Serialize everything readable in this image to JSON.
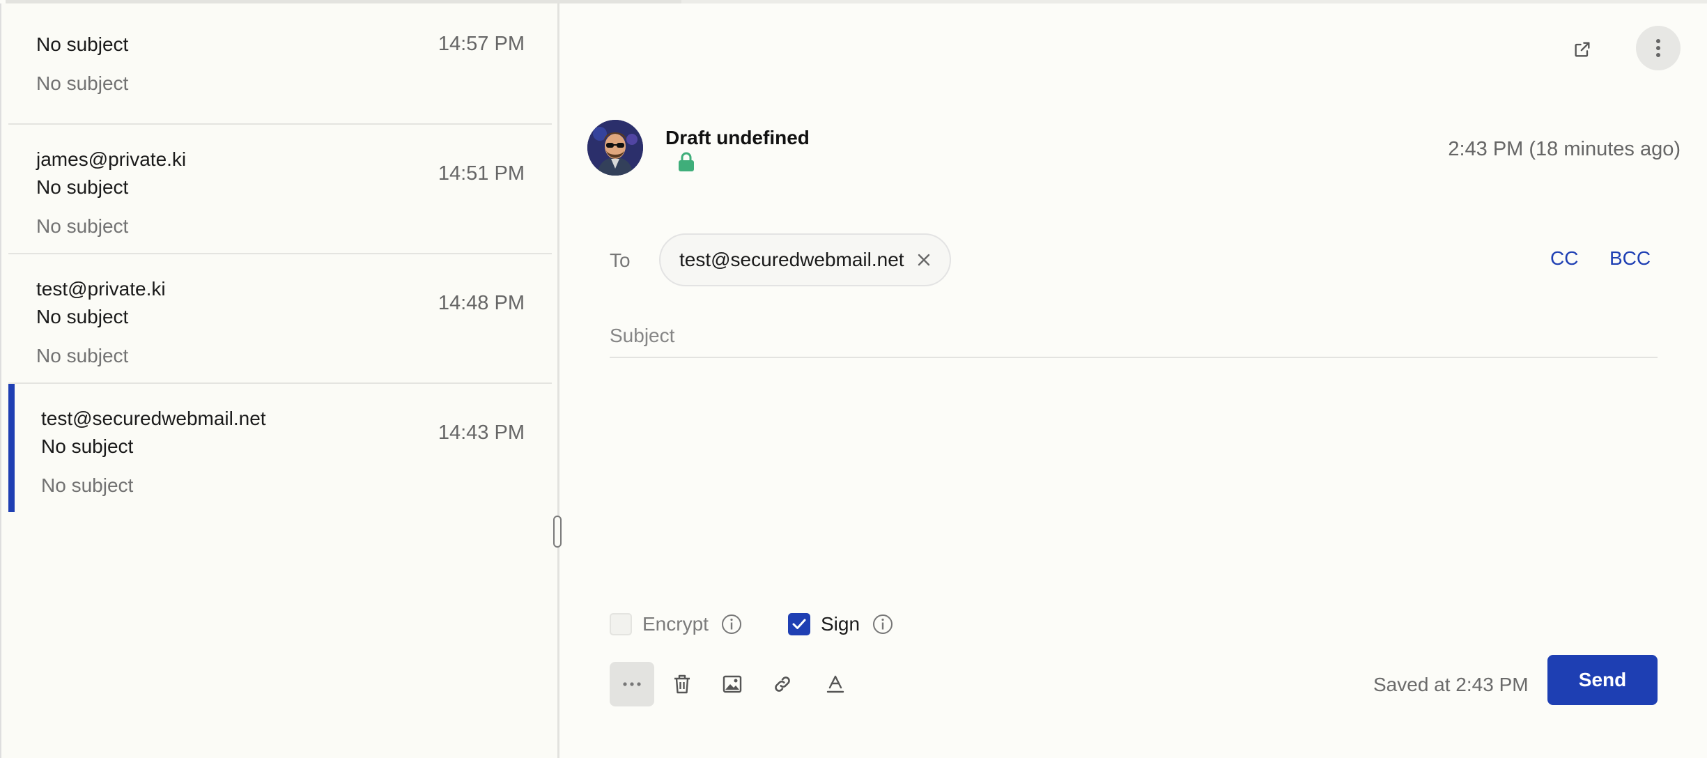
{
  "messages": [
    {
      "sender": "",
      "subject": "No subject",
      "preview": "No subject",
      "time": "14:57 PM"
    },
    {
      "sender": "james@private.ki",
      "subject": "No subject",
      "preview": "No subject",
      "time": "14:51 PM"
    },
    {
      "sender": "test@private.ki",
      "subject": "No subject",
      "preview": "No subject",
      "time": "14:48 PM"
    },
    {
      "sender": "test@securedwebmail.net",
      "subject": "No subject",
      "preview": "No subject",
      "time": "14:43 PM",
      "selected": true
    }
  ],
  "composer": {
    "header_icons": [
      "external-link-icon",
      "more-vertical-icon"
    ],
    "sender_name": "Draft undefined",
    "lock_icon": "lock-icon",
    "timestamp": "2:43 PM (18 minutes ago)",
    "to_label": "To",
    "recipients": [
      "test@securedwebmail.net"
    ],
    "cc_label": "CC",
    "bcc_label": "BCC",
    "subject_placeholder": "Subject",
    "subject_value": "",
    "body": "",
    "options": {
      "encrypt": {
        "label": "Encrypt",
        "checked": false,
        "disabled": true
      },
      "sign": {
        "label": "Sign",
        "checked": true,
        "disabled": false
      }
    },
    "toolbar_icons": [
      "more-horizontal-icon",
      "trash-icon",
      "image-icon",
      "link-icon",
      "text-format-icon"
    ],
    "saved_status": "Saved at 2:43 PM",
    "send_label": "Send"
  },
  "colors": {
    "accent": "#1e3fb3",
    "lock": "#3fae7a",
    "background": "#fcfcf8"
  }
}
